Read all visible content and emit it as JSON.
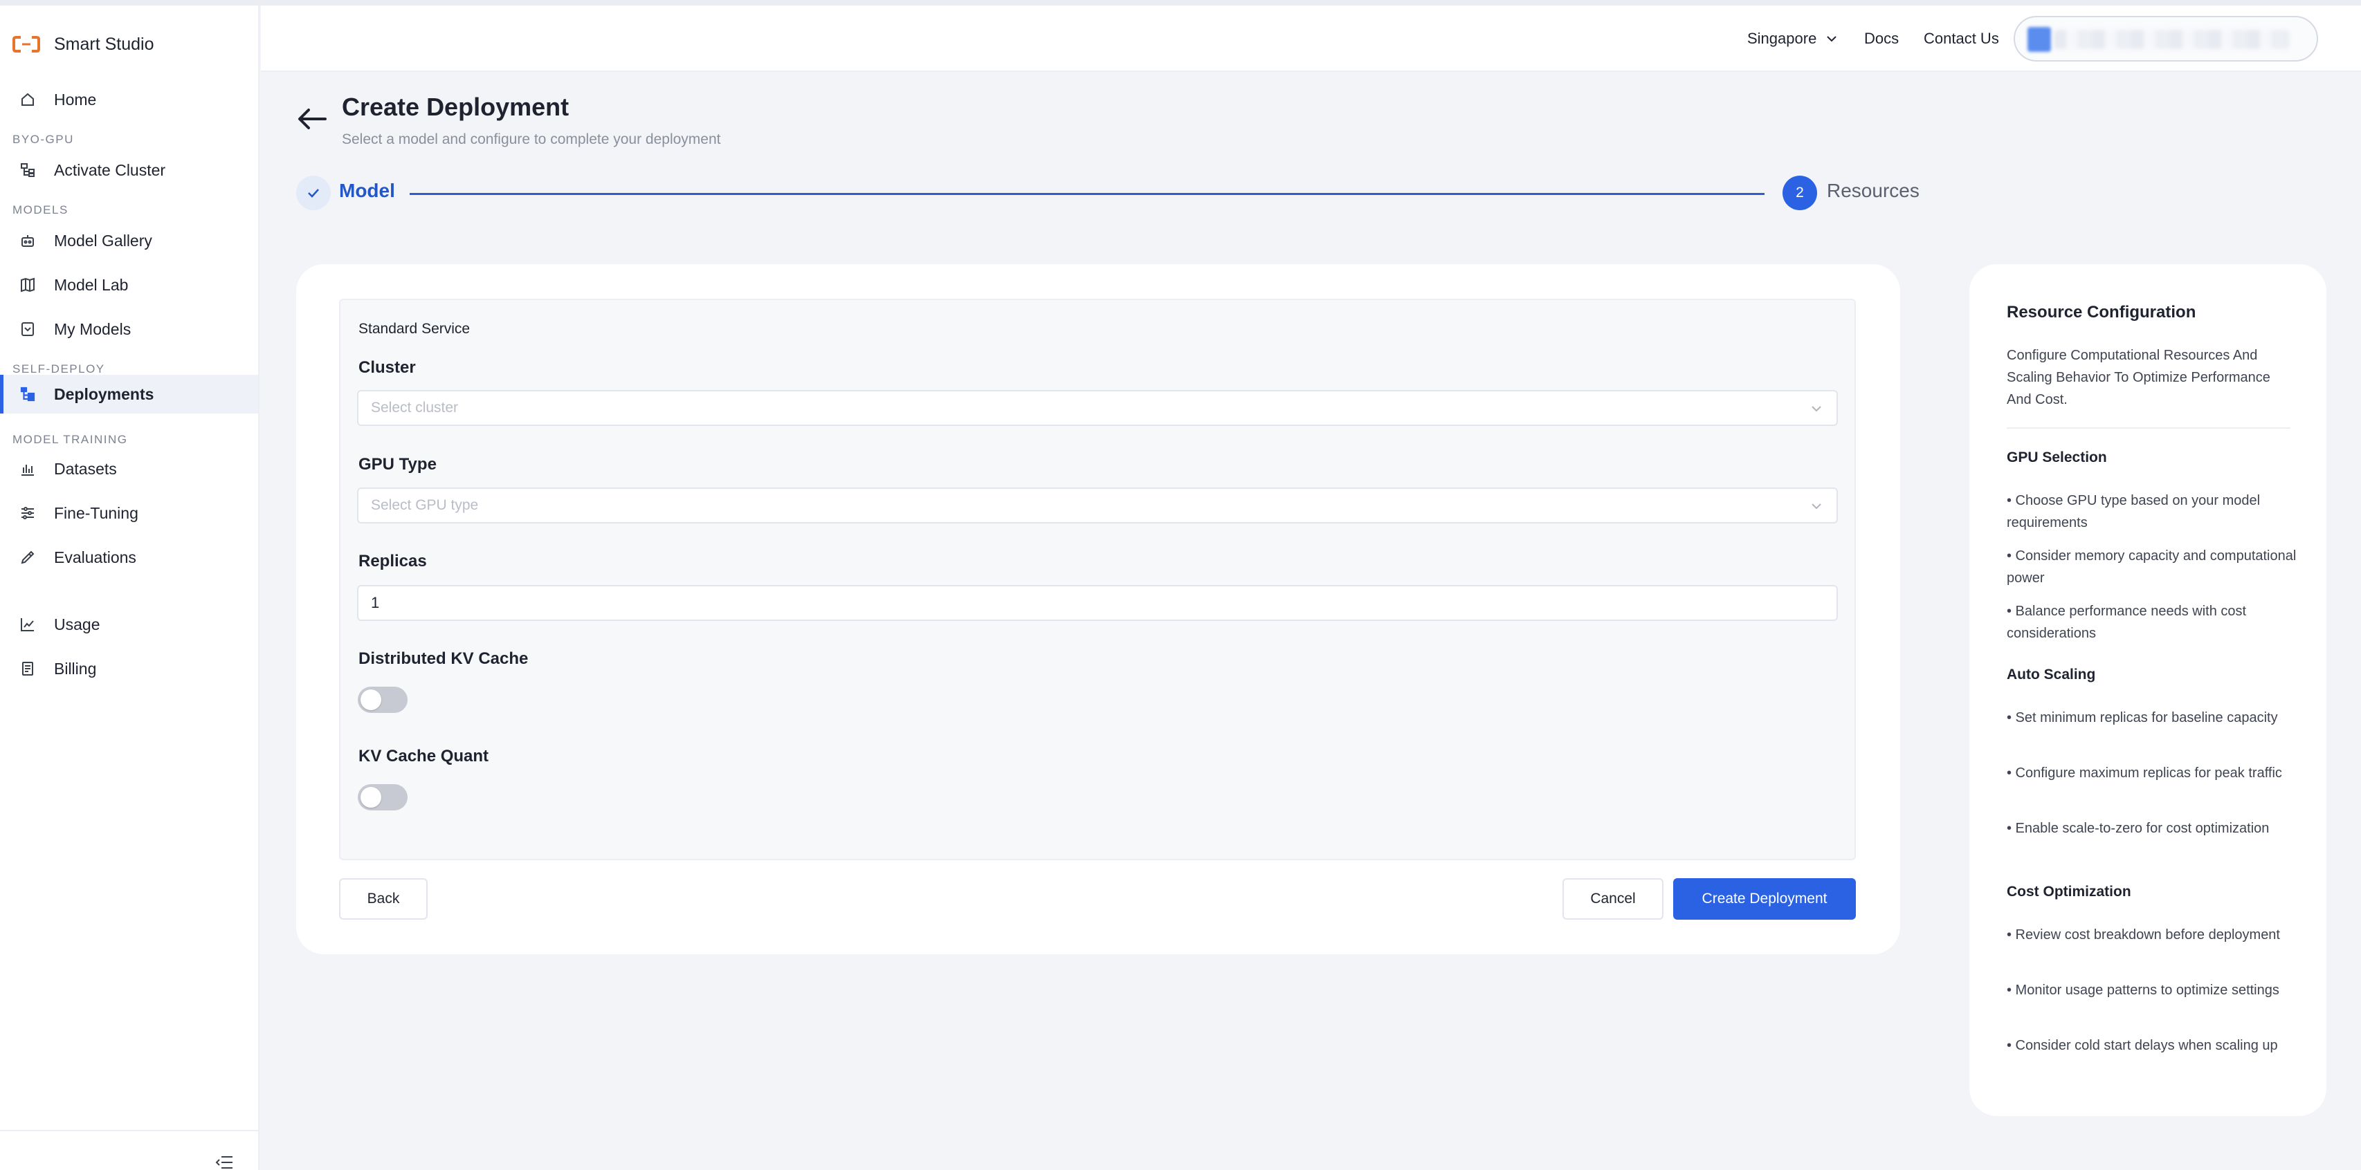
{
  "app": {
    "name": "Smart Studio",
    "accent": "#2b62e3",
    "brand_color": "#e8732a"
  },
  "sidebar": {
    "sections": {
      "byo_gpu": "BYO-GPU",
      "models": "MODELS",
      "self_deploy": "SELF-DEPLOY",
      "model_training": "MODEL TRAINING"
    },
    "items": [
      {
        "label": "Home",
        "icon": "home-icon"
      },
      {
        "label": "Activate Cluster",
        "icon": "cluster-icon"
      },
      {
        "label": "Model Gallery",
        "icon": "gallery-icon"
      },
      {
        "label": "Model Lab",
        "icon": "lab-icon"
      },
      {
        "label": "My Models",
        "icon": "models-icon"
      },
      {
        "label": "Deployments",
        "icon": "deployments-icon",
        "active": true
      },
      {
        "label": "Datasets",
        "icon": "datasets-icon"
      },
      {
        "label": "Fine-Tuning",
        "icon": "tuning-icon"
      },
      {
        "label": "Evaluations",
        "icon": "evaluations-icon"
      },
      {
        "label": "Usage",
        "icon": "usage-icon"
      },
      {
        "label": "Billing",
        "icon": "billing-icon"
      }
    ]
  },
  "header": {
    "region": "Singapore",
    "docs": "Docs",
    "contact": "Contact Us"
  },
  "page": {
    "title": "Create Deployment",
    "subtitle": "Select a model and configure to complete your deployment"
  },
  "stepper": {
    "step1_label": "Model",
    "step2_number": "2",
    "step2_label": "Resources"
  },
  "form": {
    "section_title": "Standard Service",
    "cluster_label": "Cluster",
    "cluster_placeholder": "Select cluster",
    "gpu_label": "GPU Type",
    "gpu_placeholder": "Select GPU type",
    "replicas_label": "Replicas",
    "replicas_value": "1",
    "kv_cache_label": "Distributed KV Cache",
    "kv_cache_enabled": false,
    "kv_quant_label": "KV Cache Quant",
    "kv_quant_enabled": false,
    "back_label": "Back",
    "cancel_label": "Cancel",
    "create_label": "Create Deployment"
  },
  "help": {
    "title": "Resource Configuration",
    "description": "Configure Computational Resources And Scaling Behavior To Optimize Performance And Cost.",
    "gpu_heading": "GPU Selection",
    "gpu_items": [
      "• Choose GPU type based on your model requirements",
      "• Consider memory capacity and computational power",
      "• Balance performance needs with cost considerations"
    ],
    "scaling_heading": "Auto Scaling",
    "scaling_items": [
      "• Set minimum replicas for baseline capacity",
      "• Configure maximum replicas for peak traffic",
      "• Enable scale-to-zero for cost optimization"
    ],
    "cost_heading": "Cost Optimization",
    "cost_items": [
      "• Review cost breakdown before deployment",
      "• Monitor usage patterns to optimize settings",
      "• Consider cold start delays when scaling up"
    ]
  }
}
